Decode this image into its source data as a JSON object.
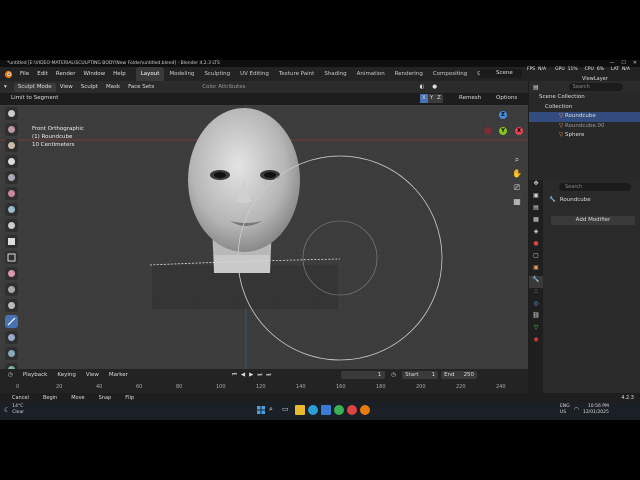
{
  "window": {
    "title": "*untitled [E:\\VIDEO-MATERIAL\\SCULPTING BODY\\New Folder\\untitled.blend] - Blender 4.2.3 LTS",
    "controls": [
      "—",
      "☐",
      "✕"
    ]
  },
  "menubar": {
    "items": [
      "File",
      "Edit",
      "Render",
      "Window",
      "Help"
    ],
    "workspaces": [
      "Layout",
      "Modeling",
      "Sculpting",
      "UV Editing",
      "Texture Paint",
      "Shading",
      "Animation",
      "Rendering",
      "Compositing",
      "Geome"
    ],
    "active_workspace": "Layout",
    "scene_label": "Scene",
    "viewlayer_label": "ViewLayer"
  },
  "viewport_header": {
    "mode": "Sculpt Mode",
    "items": [
      "View",
      "Sculpt",
      "Mask",
      "Face Sets"
    ],
    "color_attributes": "Color Attributes",
    "axes": [
      "X",
      "Y",
      "Z"
    ],
    "remesh": "Remesh",
    "options": "Options",
    "tool_setting": "Limit to Segment"
  },
  "overlay": {
    "view_name": "Front Orthographic",
    "object": "(1) Roundcube",
    "scale": "10 Centimeters"
  },
  "gizmo": {
    "x": "X",
    "y": "Y",
    "z": "Z",
    "colors": {
      "x": "#e0444e",
      "y": "#86c41b",
      "z": "#3f8ee0"
    }
  },
  "stats": {
    "fps_label": "FPS",
    "fps_value": "N/A",
    "gpu_label": "GPU",
    "gpu_value": "11%",
    "cpu_label": "CPU",
    "cpu_value": "6%",
    "lat_label": "LAT",
    "lat_value": "N/A"
  },
  "outliner": {
    "search_placeholder": "Search",
    "root": "Scene Collection",
    "collection": "Collection",
    "items": [
      {
        "label": "Roundcube",
        "selected": true
      },
      {
        "label": "Roundcube.00",
        "selected": false
      },
      {
        "label": "Sphere",
        "selected": false
      }
    ]
  },
  "properties": {
    "search_placeholder": "Search",
    "object_name": "Roundcube",
    "add_modifier": "Add Modifier"
  },
  "timeline": {
    "menus": [
      "Playback",
      "Keying",
      "View",
      "Marker"
    ],
    "current_frame": "1",
    "start_label": "Start",
    "start_value": "1",
    "end_label": "End",
    "end_value": "250",
    "ruler": [
      "0",
      "20",
      "40",
      "60",
      "80",
      "100",
      "120",
      "140",
      "160",
      "180",
      "200",
      "220",
      "240"
    ]
  },
  "statusbar": {
    "items": [
      "Cancel",
      "Begin",
      "Move",
      "Snap",
      "Flip"
    ],
    "version": "4.2.3"
  },
  "taskbar": {
    "weather_temp": "14°C",
    "weather_desc": "Clear",
    "lang": "ENG",
    "region": "US",
    "time": "10:56 PM",
    "date": "12/01/2025"
  },
  "accent": "#4772b3"
}
